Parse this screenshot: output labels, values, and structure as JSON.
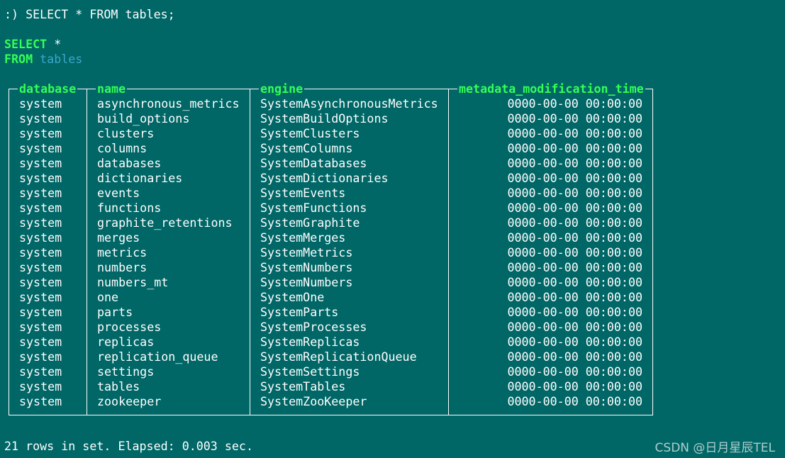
{
  "prompt": ":) ",
  "command": "SELECT * FROM tables;",
  "formatted_query": {
    "select_kw": "SELECT",
    "select_rest": " *",
    "from_kw": "FROM",
    "from_table": "tables"
  },
  "table": {
    "headers": [
      "database",
      "name",
      "engine",
      "metadata_modification_time"
    ],
    "rows": [
      [
        "system",
        "asynchronous_metrics",
        "SystemAsynchronousMetrics",
        "0000-00-00 00:00:00"
      ],
      [
        "system",
        "build_options",
        "SystemBuildOptions",
        "0000-00-00 00:00:00"
      ],
      [
        "system",
        "clusters",
        "SystemClusters",
        "0000-00-00 00:00:00"
      ],
      [
        "system",
        "columns",
        "SystemColumns",
        "0000-00-00 00:00:00"
      ],
      [
        "system",
        "databases",
        "SystemDatabases",
        "0000-00-00 00:00:00"
      ],
      [
        "system",
        "dictionaries",
        "SystemDictionaries",
        "0000-00-00 00:00:00"
      ],
      [
        "system",
        "events",
        "SystemEvents",
        "0000-00-00 00:00:00"
      ],
      [
        "system",
        "functions",
        "SystemFunctions",
        "0000-00-00 00:00:00"
      ],
      [
        "system",
        "graphite_retentions",
        "SystemGraphite",
        "0000-00-00 00:00:00"
      ],
      [
        "system",
        "merges",
        "SystemMerges",
        "0000-00-00 00:00:00"
      ],
      [
        "system",
        "metrics",
        "SystemMetrics",
        "0000-00-00 00:00:00"
      ],
      [
        "system",
        "numbers",
        "SystemNumbers",
        "0000-00-00 00:00:00"
      ],
      [
        "system",
        "numbers_mt",
        "SystemNumbers",
        "0000-00-00 00:00:00"
      ],
      [
        "system",
        "one",
        "SystemOne",
        "0000-00-00 00:00:00"
      ],
      [
        "system",
        "parts",
        "SystemParts",
        "0000-00-00 00:00:00"
      ],
      [
        "system",
        "processes",
        "SystemProcesses",
        "0000-00-00 00:00:00"
      ],
      [
        "system",
        "replicas",
        "SystemReplicas",
        "0000-00-00 00:00:00"
      ],
      [
        "system",
        "replication_queue",
        "SystemReplicationQueue",
        "0000-00-00 00:00:00"
      ],
      [
        "system",
        "settings",
        "SystemSettings",
        "0000-00-00 00:00:00"
      ],
      [
        "system",
        "tables",
        "SystemTables",
        "0000-00-00 00:00:00"
      ],
      [
        "system",
        "zookeeper",
        "SystemZooKeeper",
        "0000-00-00 00:00:00"
      ]
    ]
  },
  "footer": "21 rows in set. Elapsed: 0.003 sec.",
  "watermark": "CSDN @日月星辰TEL",
  "colors": {
    "background": "#006666",
    "keyword": "#33ff55",
    "table_name": "#3aa7c9",
    "text": "#ffffff"
  }
}
